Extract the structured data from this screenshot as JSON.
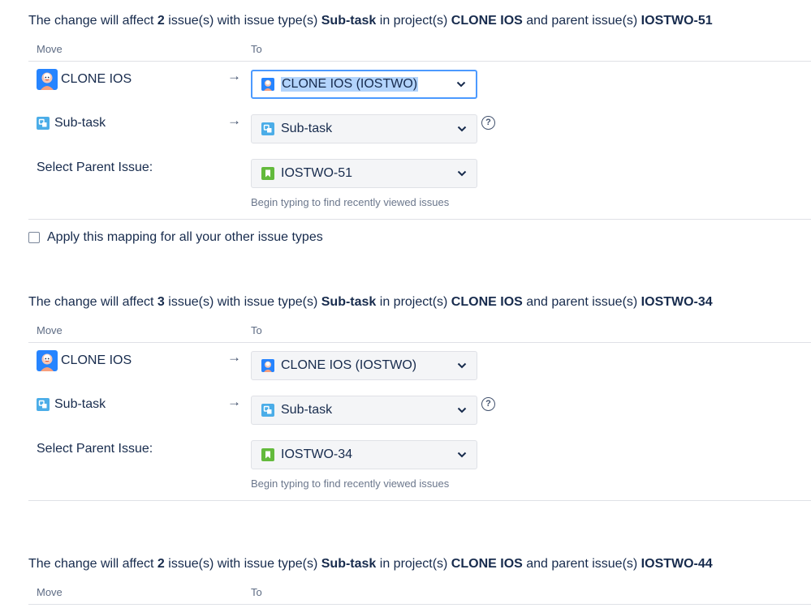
{
  "columns": {
    "move": "Move",
    "to": "To"
  },
  "sections": [
    {
      "heading": {
        "prefix": "The change will affect ",
        "count": "2",
        "middle1": " issue(s) with issue type(s) ",
        "issue_type": "Sub-task",
        "middle2": " in project(s) ",
        "project": "CLONE IOS",
        "middle3": " and parent issue(s) ",
        "parent": "IOSTWO-51"
      },
      "project_label": "CLONE IOS",
      "project_select": "CLONE IOS (IOSTWO)",
      "type_label": "Sub-task",
      "type_select": "Sub-task",
      "parent_label": "Select Parent Issue:",
      "parent_select": "IOSTWO-51",
      "hint": "Begin typing to find recently viewed issues"
    },
    {
      "heading": {
        "prefix": "The change will affect ",
        "count": "3",
        "middle1": " issue(s) with issue type(s) ",
        "issue_type": "Sub-task",
        "middle2": " in project(s) ",
        "project": "CLONE IOS",
        "middle3": " and parent issue(s) ",
        "parent": "IOSTWO-34"
      },
      "project_label": "CLONE IOS",
      "project_select": "CLONE IOS (IOSTWO)",
      "type_label": "Sub-task",
      "type_select": "Sub-task",
      "parent_label": "Select Parent Issue:",
      "parent_select": "IOSTWO-34",
      "hint": "Begin typing to find recently viewed issues"
    },
    {
      "heading": {
        "prefix": "The change will affect ",
        "count": "2",
        "middle1": " issue(s) with issue type(s) ",
        "issue_type": "Sub-task",
        "middle2": " in project(s) ",
        "project": "CLONE IOS",
        "middle3": " and parent issue(s) ",
        "parent": "IOSTWO-44"
      }
    }
  ],
  "apply_mapping_label": "Apply this mapping for all your other issue types",
  "help_glyph": "?",
  "arrow_glyph": "→",
  "icons": {
    "project": "project-avatar-icon",
    "subtask": "subtask-icon",
    "story": "story-icon",
    "chevron": "chevron-down-icon",
    "help": "help-icon"
  },
  "colors": {
    "focus_border": "#4c9aff",
    "selection": "#b3d4fc",
    "subtask_icon": "#4bade8",
    "story_icon": "#63ba3c"
  }
}
